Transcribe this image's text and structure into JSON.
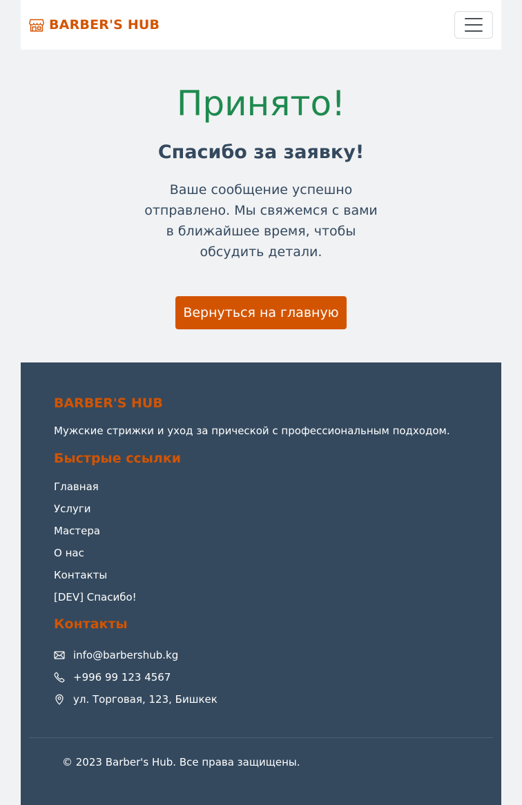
{
  "navbar": {
    "brand": "BARBER'S HUB",
    "brand_icon": "shop-icon",
    "toggle_icon": "hamburger-menu-icon"
  },
  "main": {
    "title": "Принято!",
    "subtitle": "Спасибо за заявку!",
    "message": "Ваше сообщение успешно отправлено. Мы свяжемся с вами в ближайшее время, чтобы обсудить детали.",
    "home_button": "Вернуться на главную"
  },
  "footer": {
    "brand": "BARBER'S HUB",
    "description": "Мужские стрижки и уход за прической с профессиональным подходом.",
    "quick_links_title": "Быстрые ссылки",
    "links": [
      "Главная",
      "Услуги",
      "Мастера",
      "О нас",
      "Контакты",
      "[DEV] Спасибо!"
    ],
    "contacts_title": "Контакты",
    "contacts": [
      {
        "icon": "envelope-icon",
        "text": "info@barbershub.kg"
      },
      {
        "icon": "phone-icon",
        "text": "+996 99 123 4567"
      },
      {
        "icon": "location-pin-icon",
        "text": "ул. Торговая, 123, Бишкек"
      }
    ],
    "copyright": "© 2023 Barber's Hub. Все права защищены."
  },
  "colors": {
    "accent": "#d35400",
    "success": "#1e8a4e",
    "footer_bg": "#34495e",
    "page_bg": "#f1f2f4"
  }
}
